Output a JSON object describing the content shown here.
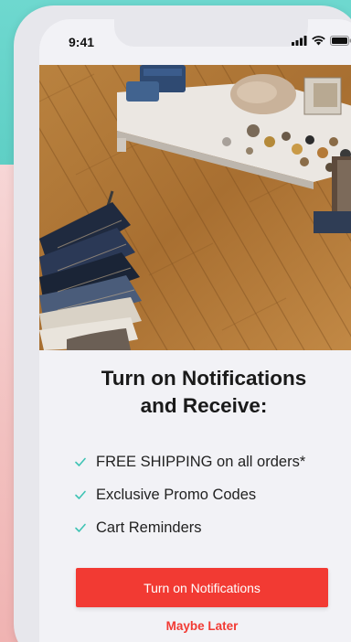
{
  "status_bar": {
    "time": "9:41",
    "icons": [
      "signal-icon",
      "wifi-icon",
      "battery-icon"
    ]
  },
  "hero": {
    "image": "clothing-store-photo"
  },
  "prompt": {
    "title_line1": "Turn on Notifications",
    "title_line2": "and Receive:"
  },
  "benefits": [
    {
      "icon": "check-icon",
      "label": "FREE SHIPPING on all orders*"
    },
    {
      "icon": "check-icon",
      "label": "Exclusive Promo Codes"
    },
    {
      "icon": "check-icon",
      "label": "Cart Reminders"
    }
  ],
  "actions": {
    "primary_label": "Turn on Notifications",
    "secondary_label": "Maybe Later"
  },
  "colors": {
    "accent": "#f23a33",
    "check": "#3fc3b4",
    "teal_background": "#5fcfc5",
    "pink_background": "#f2c1c0"
  }
}
